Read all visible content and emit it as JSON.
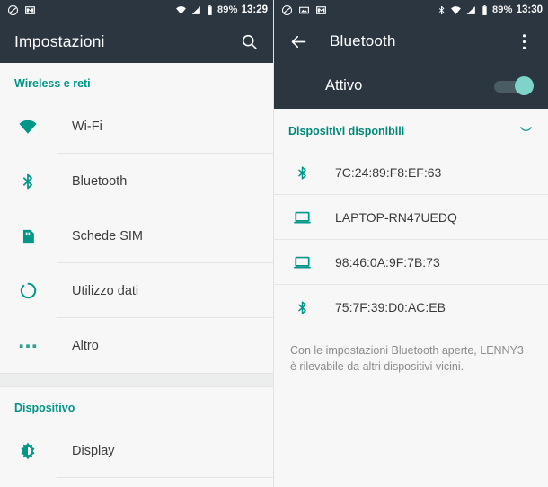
{
  "colors": {
    "accent": "#009688",
    "appbar_bg": "#2b3640",
    "panel_bg": "#f7f7f7",
    "text_primary": "#3c3c3c",
    "text_muted": "#8b8b8b",
    "toggle_thumb": "#7fd4ca"
  },
  "left_panel": {
    "statusbar": {
      "notif_icons": [
        "mute-circle-slash-icon",
        "gmail-icon"
      ],
      "status_icons": [
        "wifi-icon",
        "signal-icon",
        "battery-icon"
      ],
      "battery_percent": "89%",
      "time": "13:29"
    },
    "appbar": {
      "title": "Impostazioni",
      "search_icon": "search-icon"
    },
    "sections": [
      {
        "header": "Wireless e reti",
        "items": [
          {
            "label": "Wi-Fi",
            "icon": "wifi-icon"
          },
          {
            "label": "Bluetooth",
            "icon": "bluetooth-icon"
          },
          {
            "label": "Schede SIM",
            "icon": "sim-card-icon"
          },
          {
            "label": "Utilizzo dati",
            "icon": "data-usage-icon"
          },
          {
            "label": "Altro",
            "icon": "more-dots-icon"
          }
        ]
      },
      {
        "header": "Dispositivo",
        "items": [
          {
            "label": "Display",
            "icon": "brightness-icon"
          }
        ]
      }
    ]
  },
  "right_panel": {
    "statusbar": {
      "notif_icons": [
        "mute-circle-slash-icon",
        "screenshot-image-icon",
        "gmail-icon"
      ],
      "status_icons": [
        "bluetooth-icon",
        "wifi-icon",
        "signal-icon",
        "battery-icon"
      ],
      "battery_percent": "89%",
      "time": "13:30"
    },
    "appbar": {
      "back_icon": "back-arrow-icon",
      "title": "Bluetooth",
      "overflow_icon": "overflow-menu-icon"
    },
    "toggle": {
      "label": "Attivo",
      "state": "on"
    },
    "available": {
      "header": "Dispositivi disponibili",
      "spinner_icon": "scanning-spinner-icon",
      "devices": [
        {
          "label": "7C:24:89:F8:EF:63",
          "icon": "bluetooth-icon"
        },
        {
          "label": "LAPTOP-RN47UEDQ",
          "icon": "laptop-icon"
        },
        {
          "label": "98:46:0A:9F:7B:73",
          "icon": "laptop-icon"
        },
        {
          "label": "75:7F:39:D0:AC:EB",
          "icon": "bluetooth-icon"
        }
      ]
    },
    "footer_note": "Con le impostazioni Bluetooth aperte, LENNY3 è rilevabile da altri dispositivi vicini."
  }
}
